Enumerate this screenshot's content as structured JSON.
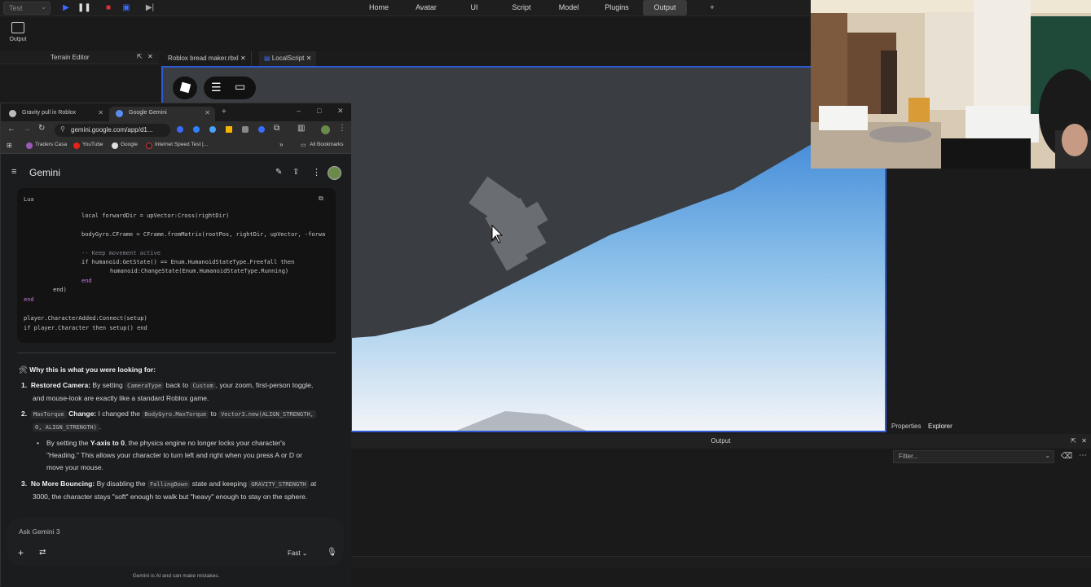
{
  "studio": {
    "test_label": "Test",
    "menu": [
      "Home",
      "Avatar",
      "UI",
      "Script",
      "Model",
      "Plugins",
      "Output",
      "+"
    ],
    "active_menu": "Output",
    "ribbon_output_label": "Output",
    "terrain_editor": "Terrain Editor",
    "tabs": [
      "Roblox bread maker.rbxl",
      "LocalScript"
    ],
    "props_tabs": [
      "Properties",
      "Explorer"
    ],
    "output_title": "Output",
    "filter_placeholder": "Filter..."
  },
  "browser": {
    "tabs": [
      "Gravity pull in Roblox",
      "Google Gemini"
    ],
    "url": "gemini.google.com/app/d1...",
    "bookmarks": [
      "Traders Casa",
      "YouTube",
      "Google",
      "Internet Speed Test |...",
      "All Bookmarks"
    ]
  },
  "gemini": {
    "title": "Gemini",
    "code_lang": "Lua",
    "code_lines": [
      "local forwardDir = upVector:Cross(rightDir)",
      "bodyGyro.CFrame = CFrame.fromMatrix(rootPos, rightDir, upVector, -forwa",
      "-- Keep movement active",
      "if humanoid:GetState() == Enum.HumanoidStateType.Freefall then",
      "humanoid:ChangeState(Enum.HumanoidStateType.Running)",
      "end",
      "end)",
      "end",
      "player.CharacterAdded:Connect(setup)",
      "if player.Character then setup() end"
    ],
    "heading": "Why this is what you were looking for:",
    "point1_title": "Restored Camera:",
    "point1_a": "By setting",
    "point1_code1": "CameraType",
    "point1_b": "back to",
    "point1_code2": "Custom",
    "point1_c": ", your zoom, first-person toggle,",
    "point1_d": "and mouse-look are exactly like a standard Roblox game.",
    "point2_code1": "MaxTorque",
    "point2_title": "Change:",
    "point2_a": "I changed the",
    "point2_code2": "BodyGyro.MaxTorque",
    "point2_b": "to",
    "point2_code3": "Vector3.new(ALIGN_STRENGTH,",
    "point2_code4": "0, ALIGN_STRENGTH)",
    "bullet_a": "By setting the",
    "bullet_b": "Y-axis to 0",
    "bullet_c": ", the physics engine no longer locks your character's",
    "bullet_d": "\"Heading.\" This allows your character to turn left and right when you press A or D or",
    "bullet_e": "move your mouse.",
    "point3_title": "No More Bouncing:",
    "point3_a": "By disabling the",
    "point3_code1": "FallingDown",
    "point3_b": "state and keeping",
    "point3_code2": "GRAVITY_STRENGTH",
    "point3_c": "at",
    "point3_d": "3000, the character stays \"soft\" enough to walk but \"heavy\" enough to stay on the sphere.",
    "ask_placeholder": "Ask Gemini 3",
    "mode": "Fast",
    "disclaimer": "Gemini is AI and can make mistakes."
  }
}
